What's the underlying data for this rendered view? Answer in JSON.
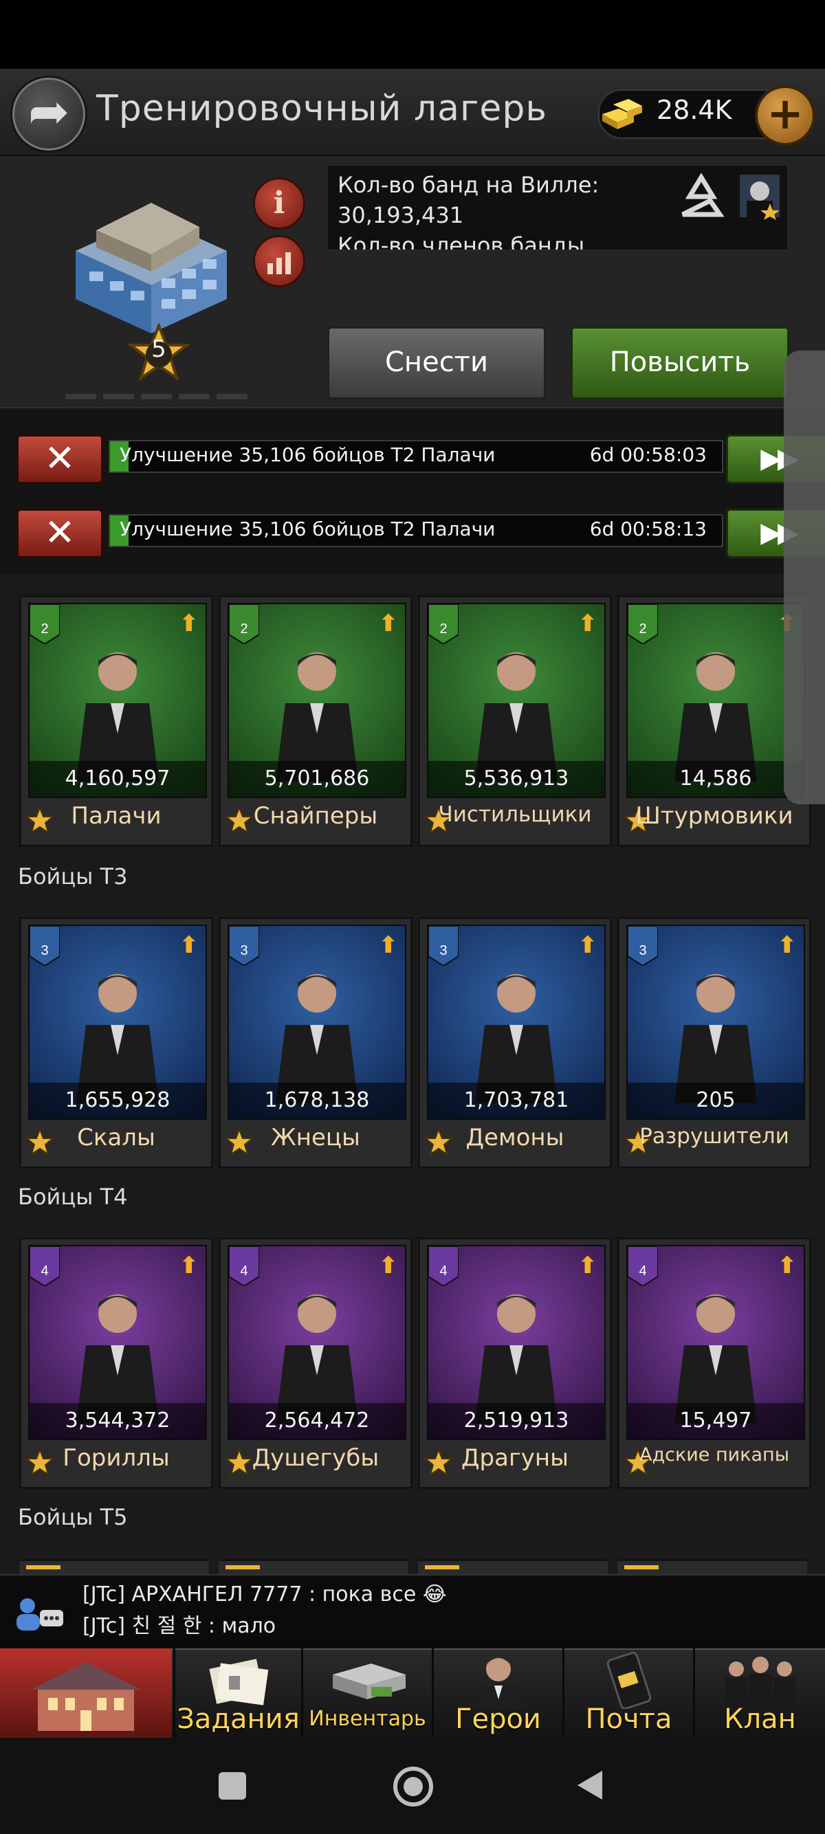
{
  "header": {
    "title": "Тренировочный лагерь",
    "gold": "28.4K",
    "building_level": "5"
  },
  "info": {
    "line1": "Кол-во банд на Вилле:",
    "line2": "30,193,431",
    "line3": "Кол-во членов банды"
  },
  "actions": {
    "demolish": "Снести",
    "upgrade": "Повысить"
  },
  "queue": [
    {
      "label": "Улучшение 35,106 бойцов T2 Палачи",
      "time": "6d 00:58:03",
      "progress": 0.03
    },
    {
      "label": "Улучшение 35,106 бойцов T2 Палачи",
      "time": "6d 00:58:13",
      "progress": 0.03
    }
  ],
  "sections": {
    "t3": "Бойцы T3",
    "t4": "Бойцы T4",
    "t5": "Бойцы T5"
  },
  "units": {
    "t2": [
      {
        "tier": "2",
        "count": "4,160,597",
        "name": "Палачи"
      },
      {
        "tier": "2",
        "count": "5,701,686",
        "name": "Снайперы"
      },
      {
        "tier": "2",
        "count": "5,536,913",
        "name": "Чистильщики"
      },
      {
        "tier": "2",
        "count": "14,586",
        "name": "Штурмовики"
      }
    ],
    "t3": [
      {
        "tier": "3",
        "count": "1,655,928",
        "name": "Скалы"
      },
      {
        "tier": "3",
        "count": "1,678,138",
        "name": "Жнецы"
      },
      {
        "tier": "3",
        "count": "1,703,781",
        "name": "Демоны"
      },
      {
        "tier": "3",
        "count": "205",
        "name": "Разрушители"
      }
    ],
    "t4": [
      {
        "tier": "4",
        "count": "3,544,372",
        "name": "Гориллы"
      },
      {
        "tier": "4",
        "count": "2,564,472",
        "name": "Душегубы"
      },
      {
        "tier": "4",
        "count": "2,519,913",
        "name": "Драгуны"
      },
      {
        "tier": "4",
        "count": "15,497",
        "name": "Адские пикапы"
      }
    ]
  },
  "chat": [
    "[JTc] АРХАНГЕЛ 7777 : пока все 😂",
    "[JTc] 친 절 한 : мало"
  ],
  "nav": {
    "tasks": "Задания",
    "inventory": "Инвентарь",
    "heroes": "Герои",
    "mail": "Почта",
    "clan": "Клан"
  },
  "colors": {
    "upgrade_green": "#3b9a2a",
    "cancel_red": "#c24a3c",
    "gold_text": "#ffd45a",
    "t2_bg": "#3e8a3a",
    "t3_bg": "#2f5fa0",
    "t4_bg": "#7a3e9e"
  }
}
